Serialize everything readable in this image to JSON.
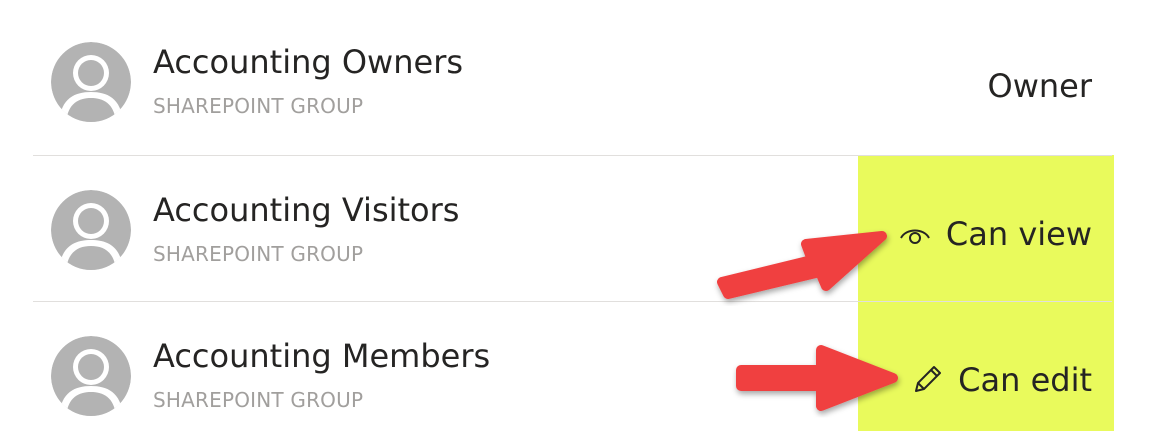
{
  "permissions": [
    {
      "name": "Accounting Owners",
      "type": "SHAREPOINT GROUP",
      "role": "Owner",
      "role_icon": "none"
    },
    {
      "name": "Accounting Visitors",
      "type": "SHAREPOINT GROUP",
      "role": "Can view",
      "role_icon": "eye-icon"
    },
    {
      "name": "Accounting Members",
      "type": "SHAREPOINT GROUP",
      "role": "Can edit",
      "role_icon": "pencil-icon"
    }
  ],
  "colors": {
    "highlight": "#e9fa5c",
    "arrow": "#f04040",
    "avatar": "#b3b3b3",
    "secondary_text": "#a19f9d"
  }
}
